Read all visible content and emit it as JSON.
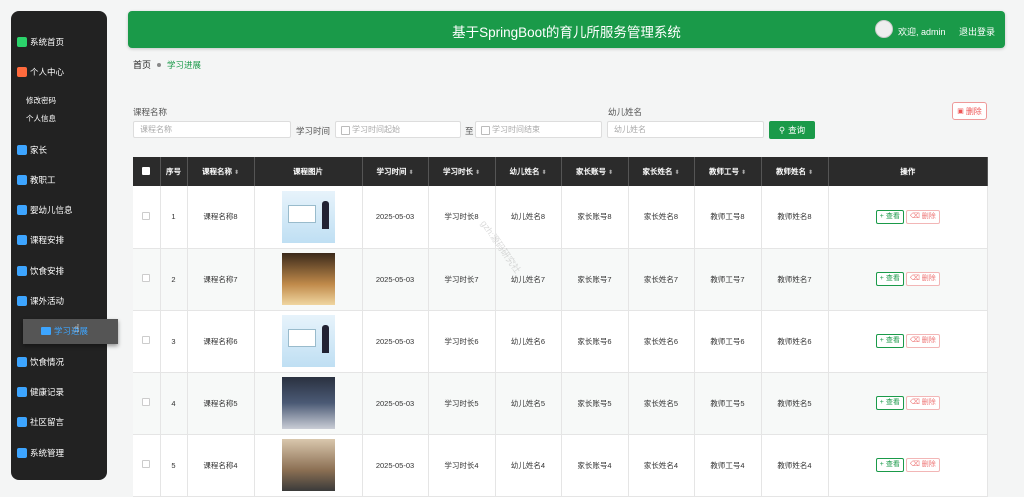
{
  "header": {
    "title": "基于SpringBoot的育儿所服务管理系统",
    "welcome": "欢迎, admin",
    "logout": "退出登录"
  },
  "breadcrumb": {
    "home": "首页",
    "current": "学习进展"
  },
  "sidebar": {
    "items": [
      {
        "label": "系统首页",
        "icon": "home-icon",
        "color": "#2bd36b"
      },
      {
        "label": "个人中心",
        "icon": "user-card-icon",
        "color": "#ff6a3d"
      },
      {
        "label": "家长",
        "icon": "send-icon",
        "color": "#3da5ff"
      },
      {
        "label": "教职工",
        "icon": "document-icon",
        "color": "#3da5ff"
      },
      {
        "label": "婴幼儿信息",
        "icon": "grid-icon",
        "color": "#3da5ff"
      },
      {
        "label": "课程安排",
        "icon": "location-icon",
        "color": "#3da5ff"
      },
      {
        "label": "饮食安排",
        "icon": "person-icon",
        "color": "#3da5ff"
      },
      {
        "label": "课外活动",
        "icon": "briefcase-icon",
        "color": "#3da5ff"
      },
      {
        "label": "学习进展",
        "icon": "folder-icon",
        "color": "#3da5ff"
      },
      {
        "label": "饮食情况",
        "icon": "list-icon",
        "color": "#3da5ff"
      },
      {
        "label": "健康记录",
        "icon": "record-icon",
        "color": "#3da5ff"
      },
      {
        "label": "社区留言",
        "icon": "apps-icon",
        "color": "#3da5ff"
      },
      {
        "label": "系统管理",
        "icon": "flag-icon",
        "color": "#3da5ff"
      }
    ],
    "sub_items": [
      "修改密码",
      "个人信息"
    ],
    "active_label": "学习进展"
  },
  "search": {
    "course_label": "课程名称",
    "course_placeholder": "课程名称",
    "time_label": "学习时间",
    "time_start_placeholder": "学习时间起始",
    "time_to": "至",
    "time_end_placeholder": "学习时间结束",
    "child_label": "幼儿姓名",
    "child_placeholder": "幼儿姓名",
    "query_button": "查询",
    "delete_button": "删除"
  },
  "table": {
    "headers": [
      "序号",
      "课程名称",
      "课程图片",
      "学习时间",
      "学习时长",
      "幼儿姓名",
      "家长账号",
      "家长姓名",
      "教师工号",
      "教师姓名",
      "操作"
    ],
    "rows": [
      {
        "no": "1",
        "course": "课程名称8",
        "img": "t1",
        "time": "2025-05-03",
        "duration": "学习时长8",
        "child": "幼儿姓名8",
        "parent_acc": "家长账号8",
        "parent_name": "家长姓名8",
        "teacher_no": "教师工号8",
        "teacher_name": "教师姓名8"
      },
      {
        "no": "2",
        "course": "课程名称7",
        "img": "t2",
        "time": "2025-05-03",
        "duration": "学习时长7",
        "child": "幼儿姓名7",
        "parent_acc": "家长账号7",
        "parent_name": "家长姓名7",
        "teacher_no": "教师工号7",
        "teacher_name": "教师姓名7"
      },
      {
        "no": "3",
        "course": "课程名称6",
        "img": "t1",
        "time": "2025-05-03",
        "duration": "学习时长6",
        "child": "幼儿姓名6",
        "parent_acc": "家长账号6",
        "parent_name": "家长姓名6",
        "teacher_no": "教师工号6",
        "teacher_name": "教师姓名6"
      },
      {
        "no": "4",
        "course": "课程名称5",
        "img": "t3",
        "time": "2025-05-03",
        "duration": "学习时长5",
        "child": "幼儿姓名5",
        "parent_acc": "家长账号5",
        "parent_name": "家长姓名5",
        "teacher_no": "教师工号5",
        "teacher_name": "教师姓名5"
      },
      {
        "no": "5",
        "course": "课程名称4",
        "img": "t4",
        "time": "2025-05-03",
        "duration": "学习时长4",
        "child": "幼儿姓名4",
        "parent_acc": "家长账号4",
        "parent_name": "家长姓名4",
        "teacher_no": "教师工号4",
        "teacher_name": "教师姓名4"
      }
    ],
    "view_label": "查看",
    "delete_label": "删除"
  },
  "watermark": "gzh:源码研究社",
  "colors": {
    "primary": "#1a9a49",
    "sidebar_bg": "#222222",
    "table_head": "#2b2b2b",
    "danger": "#e55555"
  }
}
